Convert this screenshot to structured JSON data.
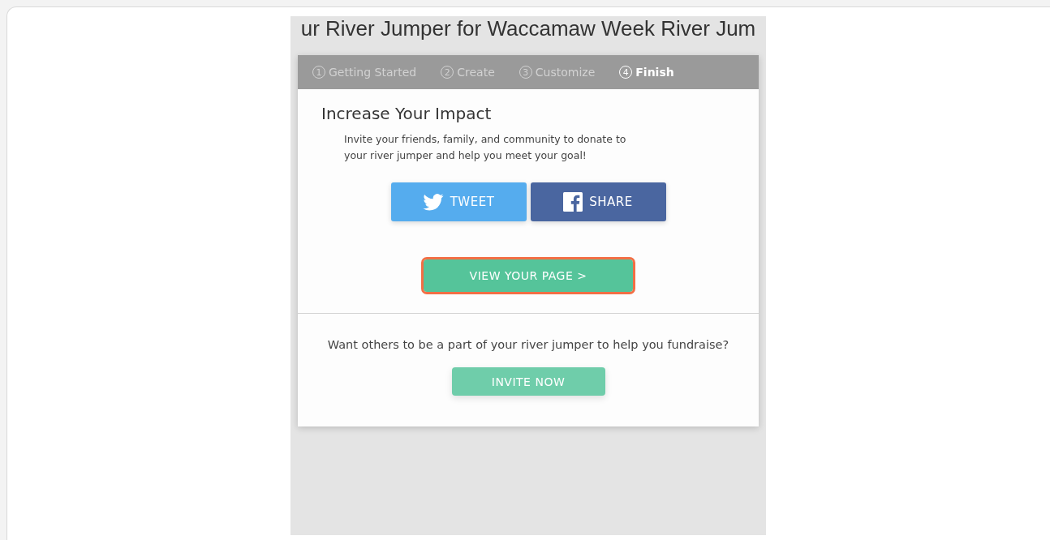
{
  "page_title": "ur River Jumper for Waccamaw Week River Jum",
  "steps": [
    {
      "number": "1",
      "label": "Getting Started",
      "selected": false
    },
    {
      "number": "2",
      "label": "Create",
      "selected": false
    },
    {
      "number": "3",
      "label": "Customize",
      "selected": false
    },
    {
      "number": "4",
      "label": "Finish",
      "selected": true
    }
  ],
  "impact": {
    "heading": "Increase Your Impact",
    "text": "Invite your friends, family, and community to donate to your river jumper and help you meet your goal!",
    "share_buttons": [
      {
        "kind": "twitter",
        "label": "TWEET"
      },
      {
        "kind": "facebook",
        "label": "SHARE"
      }
    ],
    "view_button": {
      "label": "VIEW YOUR PAGE >",
      "highlighted": true
    }
  },
  "invite": {
    "text": "Want others to be a part of your river jumper to help you fundraise?",
    "button": "INVITE NOW"
  }
}
